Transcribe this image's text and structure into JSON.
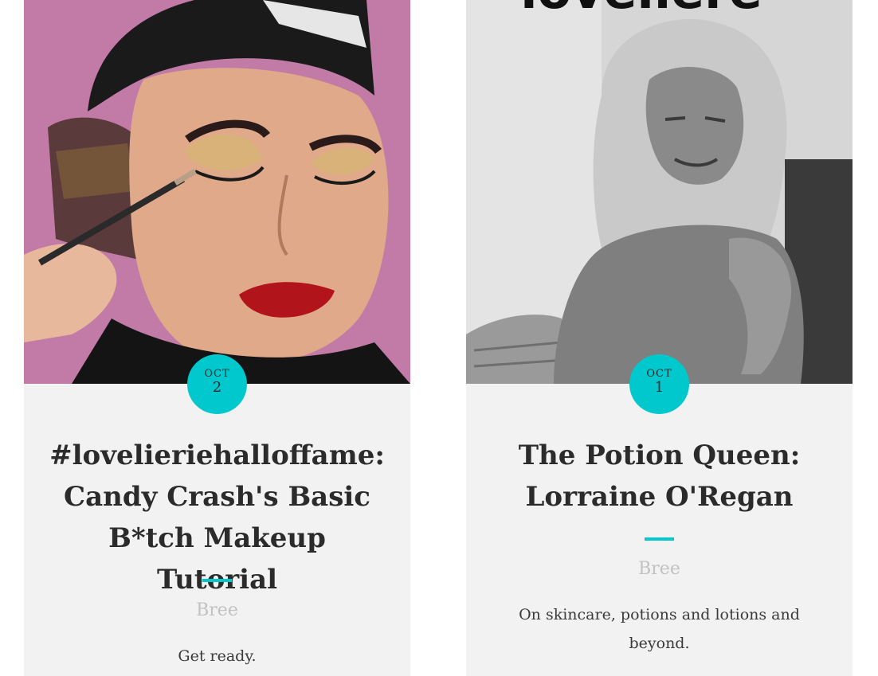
{
  "posts": [
    {
      "image_alt": "Makeup artist applying eyeshadow",
      "date": {
        "month": "OCT",
        "day": "2"
      },
      "title": "#lovelieriehalloffame: Candy Crash's Basic B*tch Makeup Tutorial",
      "author": "Bree",
      "excerpt": "Get ready."
    },
    {
      "image_alt": "Black and white portrait of Lorraine O'Regan",
      "image_overlay_text": "loveliere",
      "date": {
        "month": "OCT",
        "day": "1"
      },
      "title": "The Potion Queen: Lorraine O'Regan",
      "author": "Bree",
      "excerpt": "On skincare, potions and lotions and beyond."
    }
  ],
  "colors": {
    "accent": "#00c8cc",
    "card_bg": "#f2f2f2",
    "title": "#2b2b2b",
    "author": "#c2c2c2"
  }
}
